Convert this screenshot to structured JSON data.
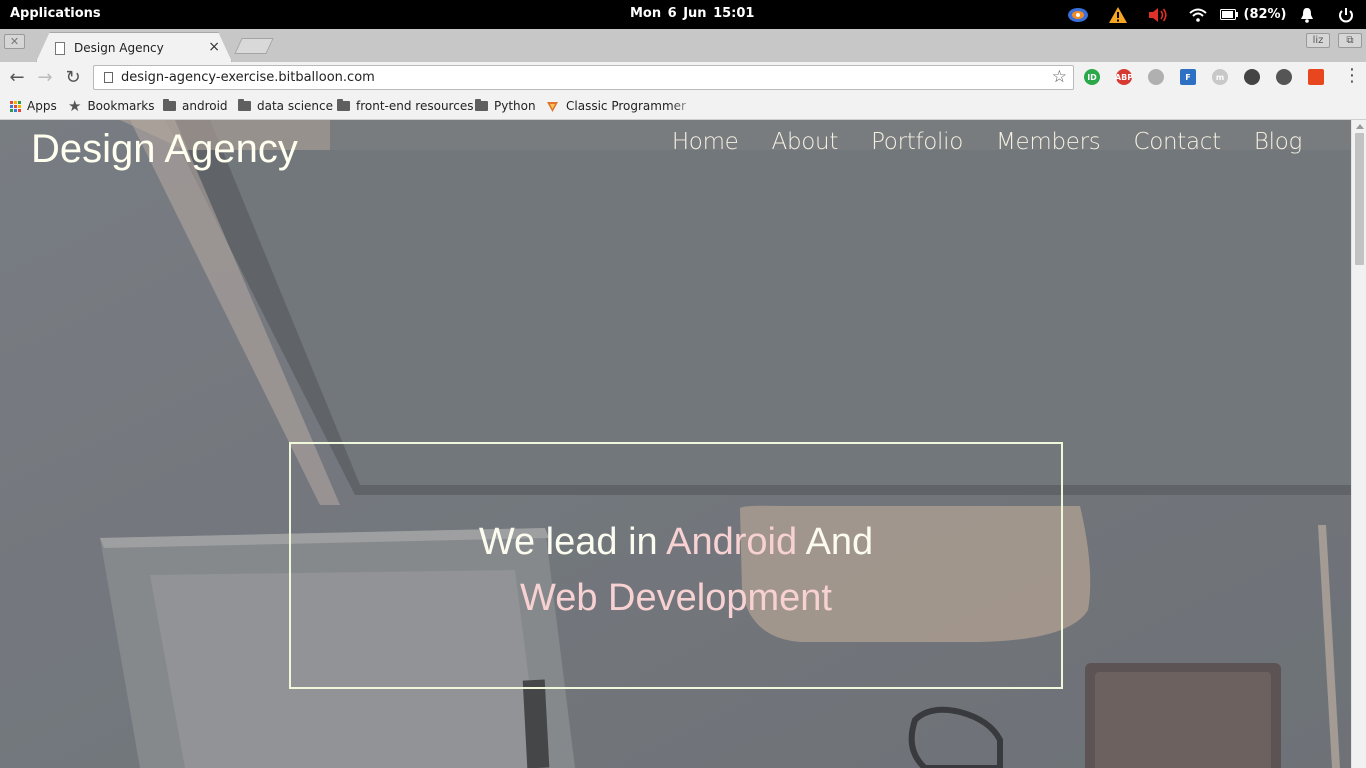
{
  "system_bar": {
    "applications_label": "Applications",
    "clock": "Mon  6 Jun   15:01",
    "battery_label": "(82%)"
  },
  "browser": {
    "tab_title": "Design Agency",
    "tab_close": "×",
    "url": "design-agency-exercise.bitballoon.com",
    "bookmarks": [
      {
        "label": "Apps",
        "icon": "apps-grid-icon"
      },
      {
        "label": "Bookmarks",
        "icon": "star-icon"
      },
      {
        "label": "android",
        "icon": "folder-icon"
      },
      {
        "label": "data science",
        "icon": "folder-icon"
      },
      {
        "label": "front-end resources",
        "icon": "folder-icon"
      },
      {
        "label": "Python",
        "icon": "folder-icon"
      },
      {
        "label": "Classic Programmer P",
        "icon": "site-favicon"
      }
    ],
    "extensions": [
      {
        "name": "id-extension-icon",
        "text": "ID",
        "color": "#2aa84a"
      },
      {
        "name": "adblock-plus-icon",
        "text": "ABP",
        "color": "#d63a32"
      },
      {
        "name": "ghost-extension-icon",
        "text": "",
        "color": "#b0b0b0"
      },
      {
        "name": "f-extension-icon",
        "text": "F",
        "color": "#2d6fc2"
      },
      {
        "name": "m-extension-icon",
        "text": "m",
        "color": "#c8c8c8"
      },
      {
        "name": "evernote-icon",
        "text": "",
        "color": "#444444"
      },
      {
        "name": "mail-icon",
        "text": "",
        "color": "#555555"
      },
      {
        "name": "office-icon",
        "text": "",
        "color": "#e8461e"
      }
    ]
  },
  "site": {
    "logo": "Design Agency",
    "nav": [
      "Home",
      "About",
      "Portfolio",
      "Members",
      "Contact",
      "Blog"
    ],
    "hero": {
      "line1_a": "We lead in ",
      "line1_accent": "Android",
      "line1_b": " And",
      "line2": "Web Development"
    },
    "colors": {
      "text": "#fbfbf0",
      "accent": "#f8d2d2",
      "box_border": "#f0f8dc"
    }
  }
}
